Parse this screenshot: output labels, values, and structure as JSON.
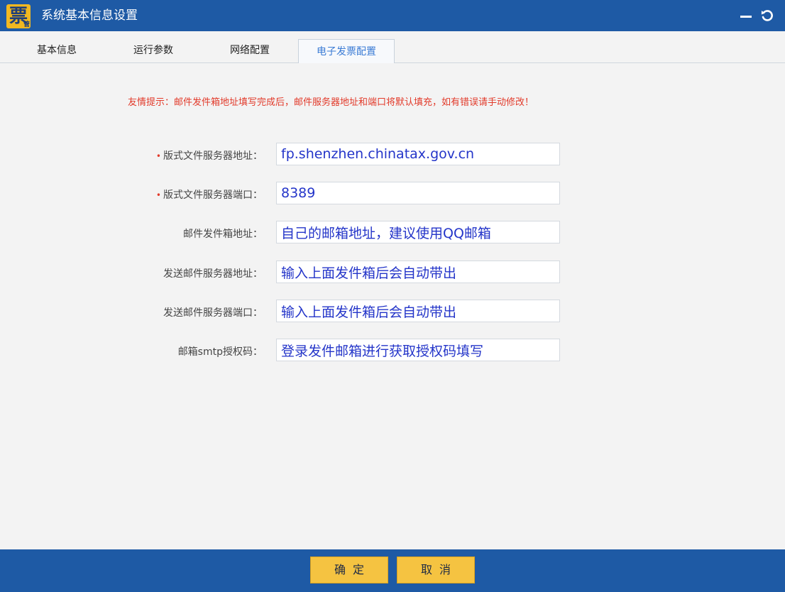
{
  "window": {
    "title": "系统基本信息设置",
    "logo_char": "票",
    "logo_sub": "管"
  },
  "tabs": [
    {
      "label": "基本信息"
    },
    {
      "label": "运行参数"
    },
    {
      "label": "网络配置"
    },
    {
      "label": "电子发票配置"
    }
  ],
  "tip": "友情提示：邮件发件箱地址填写完成后，邮件服务器地址和端口将默认填充，如有错误请手动修改！",
  "form": {
    "rows": [
      {
        "label": "版式文件服务器地址：",
        "required": "•",
        "value": "fp.shenzhen.chinatax.gov.cn"
      },
      {
        "label": "版式文件服务器端口：",
        "required": "•",
        "value": "8389"
      },
      {
        "label": "邮件发件箱地址：",
        "required": "",
        "value": "自己的邮箱地址，建议使用QQ邮箱"
      },
      {
        "label": "发送邮件服务器地址：",
        "required": "",
        "value": "输入上面发件箱后会自动带出"
      },
      {
        "label": "发送邮件服务器端口：",
        "required": "",
        "value": "输入上面发件箱后会自动带出"
      },
      {
        "label": "邮箱smtp授权码：",
        "required": "",
        "value": "登录发件邮箱进行获取授权码填写"
      }
    ]
  },
  "buttons": {
    "ok": "确定",
    "cancel": "取消"
  },
  "colors": {
    "titlebar": "#1e5aa5",
    "button": "#f5c341",
    "tip": "#e23a2a",
    "input_text": "#2435c9"
  }
}
